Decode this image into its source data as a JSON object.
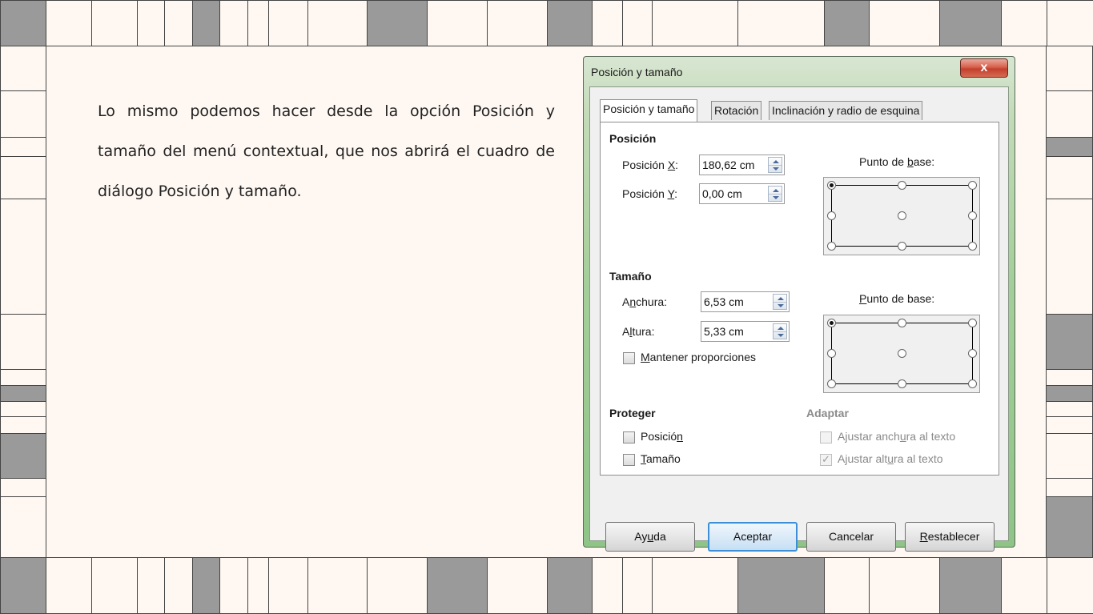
{
  "paragraph": "Lo mismo podemos hacer desde la opción Posición y tamaño del menú contextual, que nos abrirá el cuadro de diálogo Posición y tamaño.",
  "dialog": {
    "title": "Posición y tamaño",
    "close_glyph": "x",
    "tabs": [
      "Posición y tamaño",
      "Rotación",
      "Inclinación y radio de esquina"
    ],
    "position": {
      "heading": "Posición",
      "x_label_pre": "Posición ",
      "x_label_key": "X",
      "x_label_post": ":",
      "x_value": "180,62 cm",
      "y_label_pre": "Posición ",
      "y_label_key": "Y",
      "y_label_post": ":",
      "y_value": "0,00 cm",
      "base_label_pre": "Punto de ",
      "base_label_key": "b",
      "base_label_post": "ase:"
    },
    "size": {
      "heading": "Tamaño",
      "width_label_pre": "A",
      "width_label_key": "n",
      "width_label_post": "chura:",
      "width_value": "6,53 cm",
      "height_label_pre": "A",
      "height_label_key": "l",
      "height_label_post": "tura:",
      "height_value": "5,33 cm",
      "keep_ratio_key": "M",
      "keep_ratio_post": "antener proporciones",
      "base_label_key": "P",
      "base_label_post": "unto de base:"
    },
    "protect": {
      "heading": "Proteger",
      "position_pre": "Posició",
      "position_key": "n",
      "size_key": "T",
      "size_post": "amaño"
    },
    "adapt": {
      "heading": "Adaptar",
      "fit_width_pre": "Ajustar anch",
      "fit_width_key": "u",
      "fit_width_post": "ra al texto",
      "fit_height_pre": "Ajustar alt",
      "fit_height_key": "u",
      "fit_height_post": "ra al texto",
      "fit_height_tick": "✓"
    },
    "buttons": {
      "help_pre": "Ay",
      "help_key": "u",
      "help_post": "da",
      "ok": "Aceptar",
      "cancel": "Cancelar",
      "reset_key": "R",
      "reset_post": "establecer"
    }
  }
}
